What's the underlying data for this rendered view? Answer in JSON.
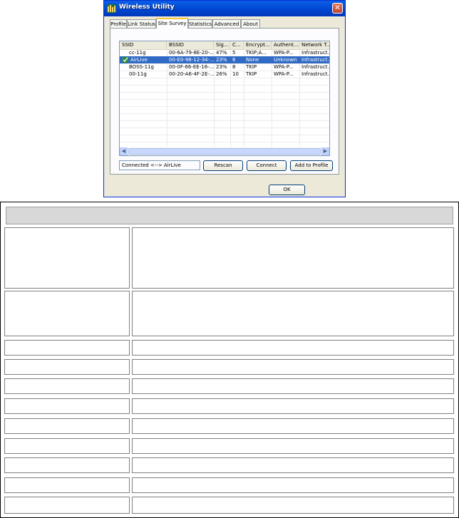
{
  "window": {
    "title": "Wireless Utility",
    "tabs": [
      {
        "label": "Profile"
      },
      {
        "label": "Link Status"
      },
      {
        "label": "Site Survey"
      },
      {
        "label": "Statistics"
      },
      {
        "label": "Advanced"
      },
      {
        "label": "About"
      }
    ],
    "active_tab": "Site Survey",
    "ok_label": "OK"
  },
  "site_survey": {
    "columns": [
      "SSID",
      "BSSID",
      "Sig...",
      "C...",
      "Encrypt...",
      "Authent...",
      "Network T..."
    ],
    "rows": [
      {
        "ssid": "cc-11g",
        "bssid": "00-6A-79-8E-20-...",
        "signal": "47%",
        "channel": "5",
        "encryption": "TKIP;A...",
        "auth": "WPA-P...",
        "network": "Infrastruct...",
        "selected": false,
        "connected": false
      },
      {
        "ssid": "AirLive",
        "bssid": "00-E0-98-12-34-...",
        "signal": "23%",
        "channel": "6",
        "encryption": "None",
        "auth": "Unknown",
        "network": "Infrastruct...",
        "selected": true,
        "connected": true
      },
      {
        "ssid": "BOSS-11g",
        "bssid": "00-0F-66-EE-16-...",
        "signal": "23%",
        "channel": "8",
        "encryption": "TKIP",
        "auth": "WPA-P...",
        "network": "Infrastruct...",
        "selected": false,
        "connected": false
      },
      {
        "ssid": "00-11g",
        "bssid": "00-20-A6-4F-2E-...",
        "signal": "26%",
        "channel": "10",
        "encryption": "TKIP",
        "auth": "WPA-P...",
        "network": "Infrastruct...",
        "selected": false,
        "connected": false
      }
    ],
    "status_text": "Connected <--> AirLive",
    "rescan_label": "Rescan",
    "connect_label": "Connect",
    "add_to_profile_label": "Add to Profile"
  },
  "colors": {
    "titlebar": "#0a5fe6",
    "selection": "#316ac5",
    "window_bg": "#ece9d8"
  }
}
